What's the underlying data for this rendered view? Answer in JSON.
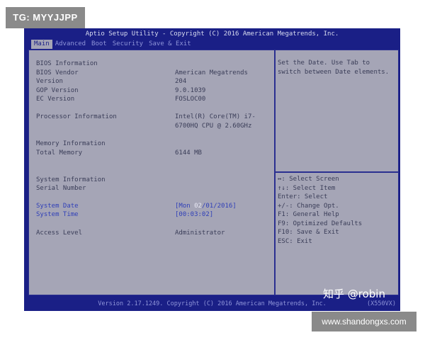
{
  "overlay": {
    "top_badge": "TG: MYYJJPP",
    "watermark": "知乎 @robin",
    "bottom_badge": "www.shandongxs.com"
  },
  "bios": {
    "title": "Aptio Setup Utility - Copyright (C) 2016 American Megatrends, Inc.",
    "tabs": [
      "Main",
      "Advanced",
      "Boot",
      "Security",
      "Save & Exit"
    ],
    "active_tab": "Main",
    "sections": {
      "bios_info": {
        "header": "BIOS Information",
        "vendor_label": "BIOS Vendor",
        "vendor_value": "American Megatrends",
        "version_label": "Version",
        "version_value": "204",
        "gop_label": "GOP Version",
        "gop_value": "9.0.1039",
        "ec_label": "EC Version",
        "ec_value": "FOSLOC00"
      },
      "processor": {
        "label": "Processor Information",
        "value_line1": "Intel(R) Core(TM) i7-",
        "value_line2": "6700HQ CPU @ 2.60GHz"
      },
      "memory": {
        "header": "Memory Information",
        "total_label": "Total Memory",
        "total_value": "6144 MB"
      },
      "system": {
        "header": "System Information",
        "serial_label": "Serial Number",
        "date_label": "System Date",
        "date_value_prefix": "[Mon ",
        "date_value_highlight": "02",
        "date_value_suffix": "/01/2016]",
        "time_label": "System Time",
        "time_value": "[00:03:02]",
        "access_label": "Access Level",
        "access_value": "Administrator"
      }
    },
    "help": {
      "description_line1": "Set the Date. Use Tab to",
      "description_line2": "switch between Date elements.",
      "keys": [
        "↔: Select Screen",
        "↑↓: Select Item",
        "Enter: Select",
        "+/-: Change Opt.",
        "F1: General Help",
        "F9: Optimized Defaults",
        "F10: Save & Exit",
        "ESC: Exit"
      ]
    },
    "footer": {
      "version": "Version 2.17.1249. Copyright (C) 2016 American Megatrends, Inc.",
      "model": "(X550VX)"
    },
    "colors": {
      "frame_blue": "#1a1f86",
      "panel_gray": "#a5a5b6",
      "selected_field_blue": "#2f3fb8"
    }
  }
}
